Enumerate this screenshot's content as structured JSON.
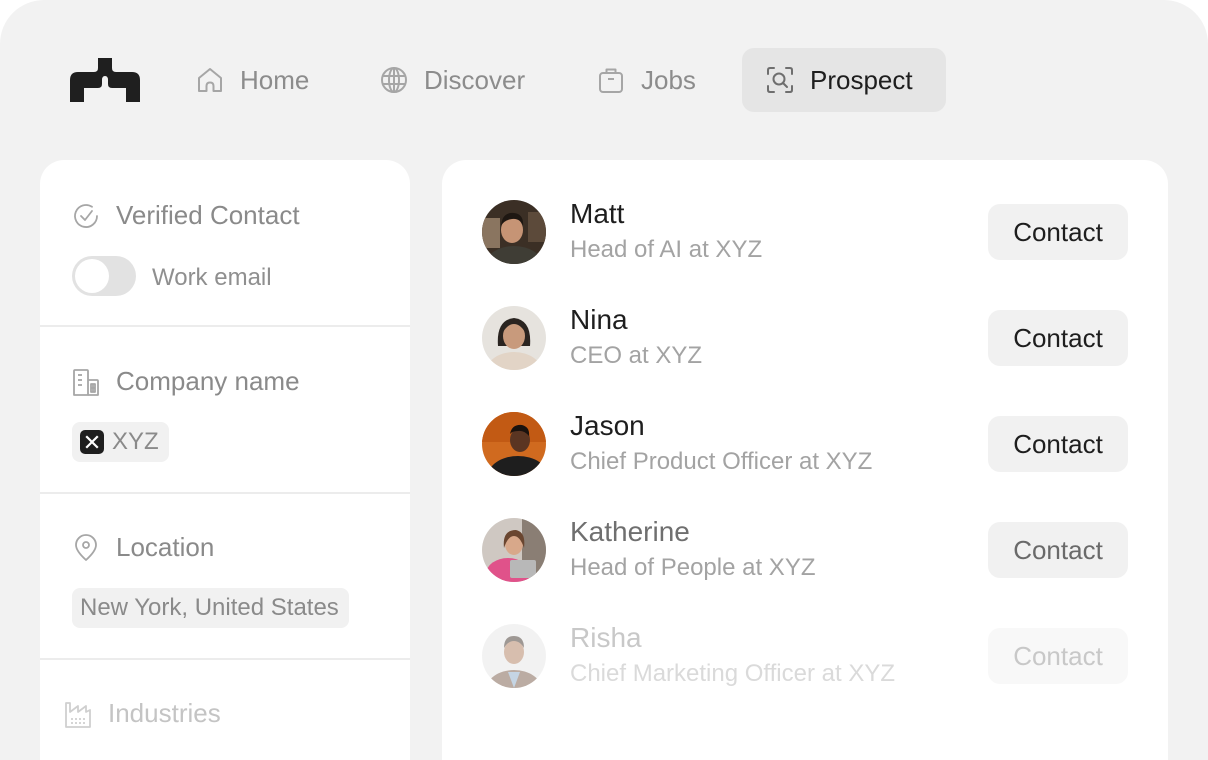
{
  "nav": {
    "logo": "brand-logo",
    "items": [
      {
        "label": "Home",
        "icon": "home-icon",
        "active": false
      },
      {
        "label": "Discover",
        "icon": "globe-icon",
        "active": false
      },
      {
        "label": "Jobs",
        "icon": "briefcase-icon",
        "active": false
      },
      {
        "label": "Prospect",
        "icon": "scan-search-icon",
        "active": true
      }
    ]
  },
  "filters": {
    "verified_contact": {
      "title": "Verified Contact",
      "icon": "check-circle-icon",
      "toggle_label": "Work email",
      "toggle_on": false
    },
    "company": {
      "title": "Company name",
      "icon": "building-icon",
      "chip": "XYZ"
    },
    "location": {
      "title": "Location",
      "icon": "map-pin-icon",
      "chip": "New York, United States"
    },
    "industries": {
      "title": "Industries",
      "icon": "factory-icon"
    }
  },
  "results": {
    "button_label": "Contact",
    "people": [
      {
        "name": "Matt",
        "title": "Head of AI at XYZ"
      },
      {
        "name": "Nina",
        "title": "CEO at XYZ"
      },
      {
        "name": "Jason",
        "title": "Chief Product Officer at XYZ"
      },
      {
        "name": "Katherine",
        "title": "Head of People at XYZ"
      },
      {
        "name": "Risha",
        "title": "Chief Marketing Officer at XYZ"
      }
    ]
  },
  "colors": {
    "background": "#f2f2f2",
    "card": "#ffffff",
    "active_tab": "#e5e5e5",
    "text_primary": "#1e1e1e",
    "text_muted": "#8c8c8c"
  }
}
